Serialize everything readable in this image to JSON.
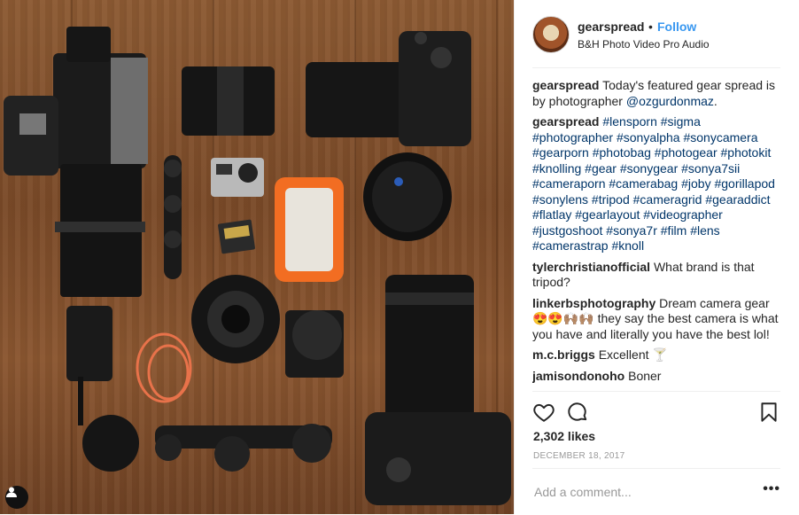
{
  "header": {
    "username": "gearspread",
    "separator": "•",
    "follow_label": "Follow",
    "location": "B&H Photo Video Pro Audio"
  },
  "caption": {
    "author": "gearspread",
    "text_before": "Today's featured gear spread is by photographer ",
    "mention": "@ozgurdonmaz",
    "text_after": "."
  },
  "hashtag_comment": {
    "author": "gearspread",
    "hashtags": "#lensporn #sigma #photographer #sonyalpha #sonycamera #gearporn #photobag #photogear #photokit #knolling #gear #sonygear #sonya7sii #cameraporn #camerabag #joby #gorillapod #sonylens #tripod #cameragrid #gearaddict #flatlay #gearlayout #videographer #justgoshoot #sonya7r #film #lens #camerastrap #knoll"
  },
  "comments": [
    {
      "author": "tylerchristianofficial",
      "text": "What brand is that tripod?"
    },
    {
      "author": "linkerbsphotography",
      "text": "Dream camera gear 😍😍🙌🏽🙌🏽 they say the best camera is what you have and literally you have the best lol!"
    },
    {
      "author": "m.c.briggs",
      "text": "Excellent 🍸"
    },
    {
      "author": "jamisondonoho",
      "text": "Boner"
    }
  ],
  "actions": {
    "like_icon": "heart-icon",
    "comment_icon": "comment-icon",
    "save_icon": "bookmark-icon"
  },
  "likes": "2,302 likes",
  "date": "DECEMBER 18, 2017",
  "add_comment": {
    "placeholder": "Add a comment...",
    "more_label": "•••"
  },
  "colors": {
    "link": "#003569",
    "follow": "#3897f0",
    "muted": "#999999"
  }
}
